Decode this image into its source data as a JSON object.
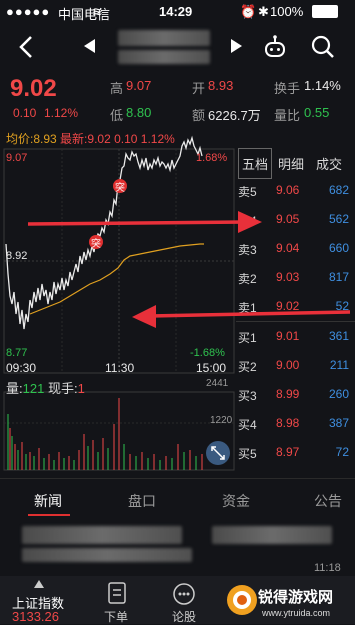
{
  "status_bar": {
    "carrier": "中国电信",
    "time": "14:29",
    "battery": "100%"
  },
  "quote": {
    "price": "9.02",
    "change": "0.10",
    "change_pct": "1.12%",
    "high_label": "高",
    "high": "9.07",
    "low_label": "低",
    "low": "8.80",
    "open_label": "开",
    "open": "8.93",
    "amount_label": "额",
    "amount": "6226.7万",
    "turnover_label": "换手",
    "turnover": "1.14%",
    "volume_ratio_label": "量比",
    "volume_ratio": "0.55"
  },
  "chart": {
    "avg_label": "均价:",
    "avg": "8.93",
    "latest_label": "最新:",
    "latest": "9.02",
    "latest_change": "0.10",
    "latest_pct": "1.12%",
    "y_high": "9.07",
    "y_mid": "8.92",
    "y_low": "8.77",
    "pct_high": "1.68%",
    "pct_low": "-1.68%",
    "t_start": "09:30",
    "t_mid": "11:30",
    "t_end": "15:00",
    "marker1": "突",
    "marker2": "突",
    "vol_label": "量:",
    "vol": "121",
    "hand_label": "现手:",
    "hand": "1",
    "vol_high": "2441",
    "vol_mid": "1220"
  },
  "chart_data": {
    "type": "line",
    "x": [
      "09:30",
      "11:30",
      "15:00"
    ],
    "series": [],
    "ylim": [
      8.77,
      9.07
    ]
  },
  "book": {
    "tabs": [
      "五档",
      "明细",
      "成交"
    ],
    "rows": [
      {
        "label": "卖5",
        "price": "9.06",
        "vol": "682"
      },
      {
        "label": "卖4",
        "price": "9.05",
        "vol": "562"
      },
      {
        "label": "卖3",
        "price": "9.04",
        "vol": "660"
      },
      {
        "label": "卖2",
        "price": "9.03",
        "vol": "817"
      },
      {
        "label": "卖1",
        "price": "9.02",
        "vol": "52"
      },
      {
        "label": "买1",
        "price": "9.01",
        "vol": "361"
      },
      {
        "label": "买2",
        "price": "9.00",
        "vol": "211"
      },
      {
        "label": "买3",
        "price": "8.99",
        "vol": "260"
      },
      {
        "label": "买4",
        "price": "8.98",
        "vol": "387"
      },
      {
        "label": "买5",
        "price": "8.97",
        "vol": "72"
      }
    ]
  },
  "bottom_tabs": [
    "新闻",
    "盘口",
    "资金",
    "公告"
  ],
  "news": {
    "time": "11:18"
  },
  "footer": {
    "index_label": "上证指数",
    "index_value": "3133.26",
    "order_label": "下单",
    "forum_label": "论股",
    "watermark": "锐得游戏网",
    "watermark_url": "www.ytruida.com"
  },
  "colors": {
    "up": "#f04848",
    "down": "#2fc24f",
    "accent": "#3f8fe0",
    "bg": "#131418"
  }
}
